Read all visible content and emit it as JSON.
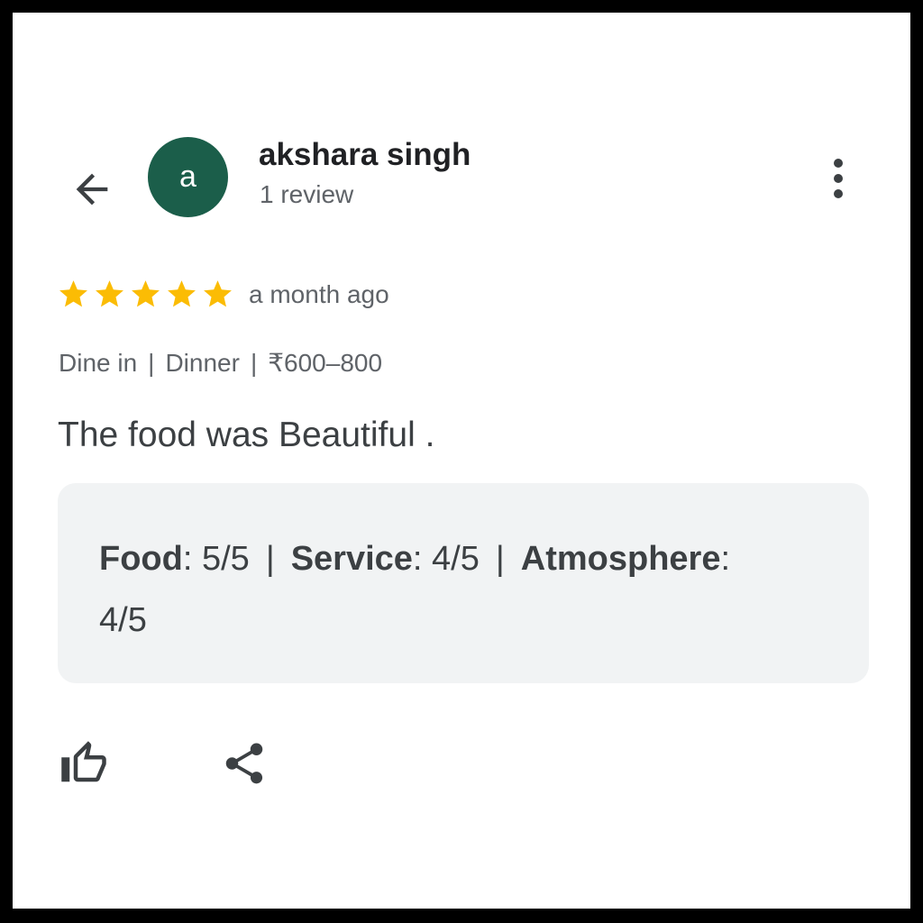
{
  "colors": {
    "avatar_bg": "#1b5e4a",
    "star": "#fbbc04",
    "icon": "#3c4043",
    "panel_bg": "#f1f3f4"
  },
  "header": {
    "back_icon": "arrow-left-icon",
    "avatar_letter": "a",
    "author_name": "akshara singh",
    "review_count": "1 review",
    "more_icon": "more-vertical-icon"
  },
  "review": {
    "rating": 5,
    "max_rating": 5,
    "time_ago": "a month ago",
    "meta": {
      "service_type": "Dine in",
      "meal_type": "Dinner",
      "price": "₹600–800",
      "separator": "|"
    },
    "text": "The food was Beautiful ."
  },
  "ratings": {
    "food_label": "Food",
    "food_value": ": 5/5",
    "service_label": "Service",
    "service_value": ": 4/5",
    "atmosphere_label": "Atmosphere",
    "atmosphere_value": ":",
    "atmosphere_score": "4/5",
    "separator": "|"
  },
  "actions": {
    "like_icon": "thumbs-up-icon",
    "share_icon": "share-icon"
  }
}
